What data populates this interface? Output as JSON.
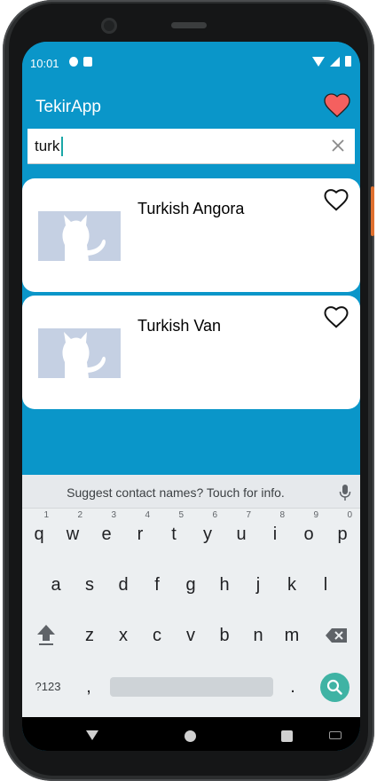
{
  "status_bar": {
    "time": "10:01"
  },
  "app": {
    "title": "TekirApp"
  },
  "search": {
    "value": "turk"
  },
  "results": [
    {
      "name": "Turkish Angora"
    },
    {
      "name": "Turkish Van"
    }
  ],
  "keyboard": {
    "suggestion": "Suggest contact names? Touch for info.",
    "row1": [
      {
        "key": "q",
        "hint": "1"
      },
      {
        "key": "w",
        "hint": "2"
      },
      {
        "key": "e",
        "hint": "3"
      },
      {
        "key": "r",
        "hint": "4"
      },
      {
        "key": "t",
        "hint": "5"
      },
      {
        "key": "y",
        "hint": "6"
      },
      {
        "key": "u",
        "hint": "7"
      },
      {
        "key": "i",
        "hint": "8"
      },
      {
        "key": "o",
        "hint": "9"
      },
      {
        "key": "p",
        "hint": "0"
      }
    ],
    "row2": [
      "a",
      "s",
      "d",
      "f",
      "g",
      "h",
      "j",
      "k",
      "l"
    ],
    "row3": [
      "z",
      "x",
      "c",
      "v",
      "b",
      "n",
      "m"
    ],
    "symbols_key": "?123",
    "comma_key": ",",
    "period_key": "."
  },
  "colors": {
    "primary": "#0a96c9",
    "favorite_heart": "#f4605f",
    "enter_key": "#3fb3a4",
    "thumbnail": "#c5d0e3"
  },
  "icons": {
    "favorites": "heart-filled-icon",
    "card_favorite": "heart-outline-icon",
    "clear": "close-icon",
    "mic": "mic-icon",
    "shift": "shift-icon",
    "delete": "backspace-icon",
    "enter": "search-icon"
  }
}
